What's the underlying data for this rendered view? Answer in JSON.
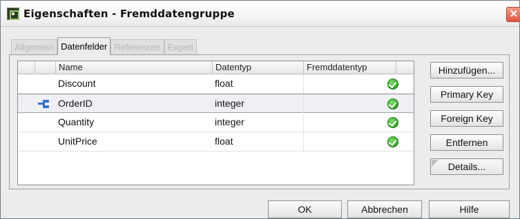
{
  "window": {
    "title": "Eigenschaften - Fremddatengruppe",
    "close_symbol": "✕"
  },
  "tabs": [
    {
      "label": "Allgemein",
      "active": false
    },
    {
      "label": "Datenfelder",
      "active": true
    },
    {
      "label": "Referenzen",
      "active": false
    },
    {
      "label": "Expert",
      "active": false
    }
  ],
  "table": {
    "columns": [
      "Name",
      "Datentyp",
      "Fremddatentyp"
    ],
    "rows": [
      {
        "name": "Discount",
        "type": "float",
        "foreign_type": "",
        "status_icon": "check-icon",
        "key_icon": null,
        "selected": false
      },
      {
        "name": "OrderID",
        "type": "integer",
        "foreign_type": "",
        "status_icon": "check-icon",
        "key_icon": "primary-key-icon",
        "selected": true
      },
      {
        "name": "Quantity",
        "type": "integer",
        "foreign_type": "",
        "status_icon": "check-icon",
        "key_icon": null,
        "selected": false
      },
      {
        "name": "UnitPrice",
        "type": "float",
        "foreign_type": "",
        "status_icon": "check-icon",
        "key_icon": null,
        "selected": false
      }
    ]
  },
  "side_buttons": {
    "add": "Hinzufügen...",
    "primary_key": "Primary Key",
    "foreign_key": "Foreign Key",
    "remove": "Entfernen",
    "details": "Details..."
  },
  "footer_buttons": {
    "ok": "OK",
    "cancel": "Abbrechen",
    "help": "Hilfe"
  },
  "colors": {
    "accent_close": "#e1533f",
    "status_ok": "#28a11d",
    "key_icon": "#2f6fd8"
  }
}
